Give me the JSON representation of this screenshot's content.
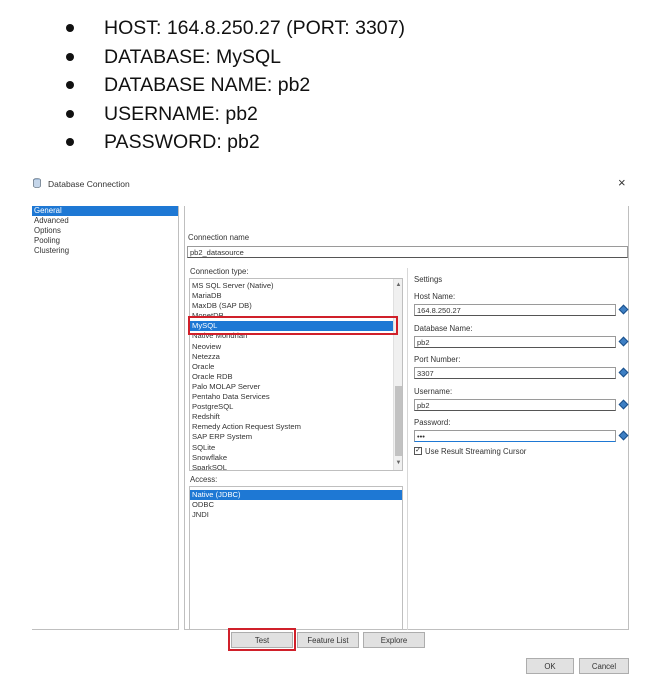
{
  "info_bullets": [
    "HOST: 164.8.250.27 (PORT: 3307)",
    "DATABASE: MySQL",
    "DATABASE NAME: pb2",
    "USERNAME: pb2",
    "PASSWORD: pb2"
  ],
  "dialog": {
    "title": "Database Connection",
    "close_glyph": "×",
    "nav_items": [
      "General",
      "Advanced",
      "Options",
      "Pooling",
      "Clustering"
    ],
    "connection_name_label": "Connection name",
    "connection_name_value": "pb2_datasource",
    "connection_type_label": "Connection type:",
    "connection_types": [
      "MS SQL Server (Native)",
      "MariaDB",
      "MaxDB (SAP DB)",
      "MonetDB",
      "MySQL",
      "Native Mondrian",
      "Neoview",
      "Netezza",
      "Oracle",
      "Oracle RDB",
      "Palo MOLAP Server",
      "Pentaho Data Services",
      "PostgreSQL",
      "Redshift",
      "Remedy Action Request System",
      "SAP ERP System",
      "SQLite",
      "Snowflake",
      "SparkSQL"
    ],
    "selected_connection_type": "MySQL",
    "access_label": "Access:",
    "access_items": [
      "Native (JDBC)",
      "ODBC",
      "JNDI"
    ],
    "selected_access": "Native (JDBC)",
    "settings": {
      "title": "Settings",
      "host_label": "Host Name:",
      "host_value": "164.8.250.27",
      "dbname_label": "Database Name:",
      "dbname_value": "pb2",
      "port_label": "Port Number:",
      "port_value": "3307",
      "username_label": "Username:",
      "username_value": "pb2",
      "password_label": "Password:",
      "password_value": "•••",
      "cursor_checkbox_label": "Use Result Streaming Cursor",
      "cursor_checked": true,
      "check_glyph": "✓"
    },
    "buttons": {
      "test": "Test",
      "feature_list": "Feature List",
      "explore": "Explore",
      "ok": "OK",
      "cancel": "Cancel"
    },
    "scroll_up_glyph": "▲",
    "scroll_down_glyph": "▼",
    "highlight_color": "#d0202a",
    "selection_color": "#1e78d4"
  }
}
